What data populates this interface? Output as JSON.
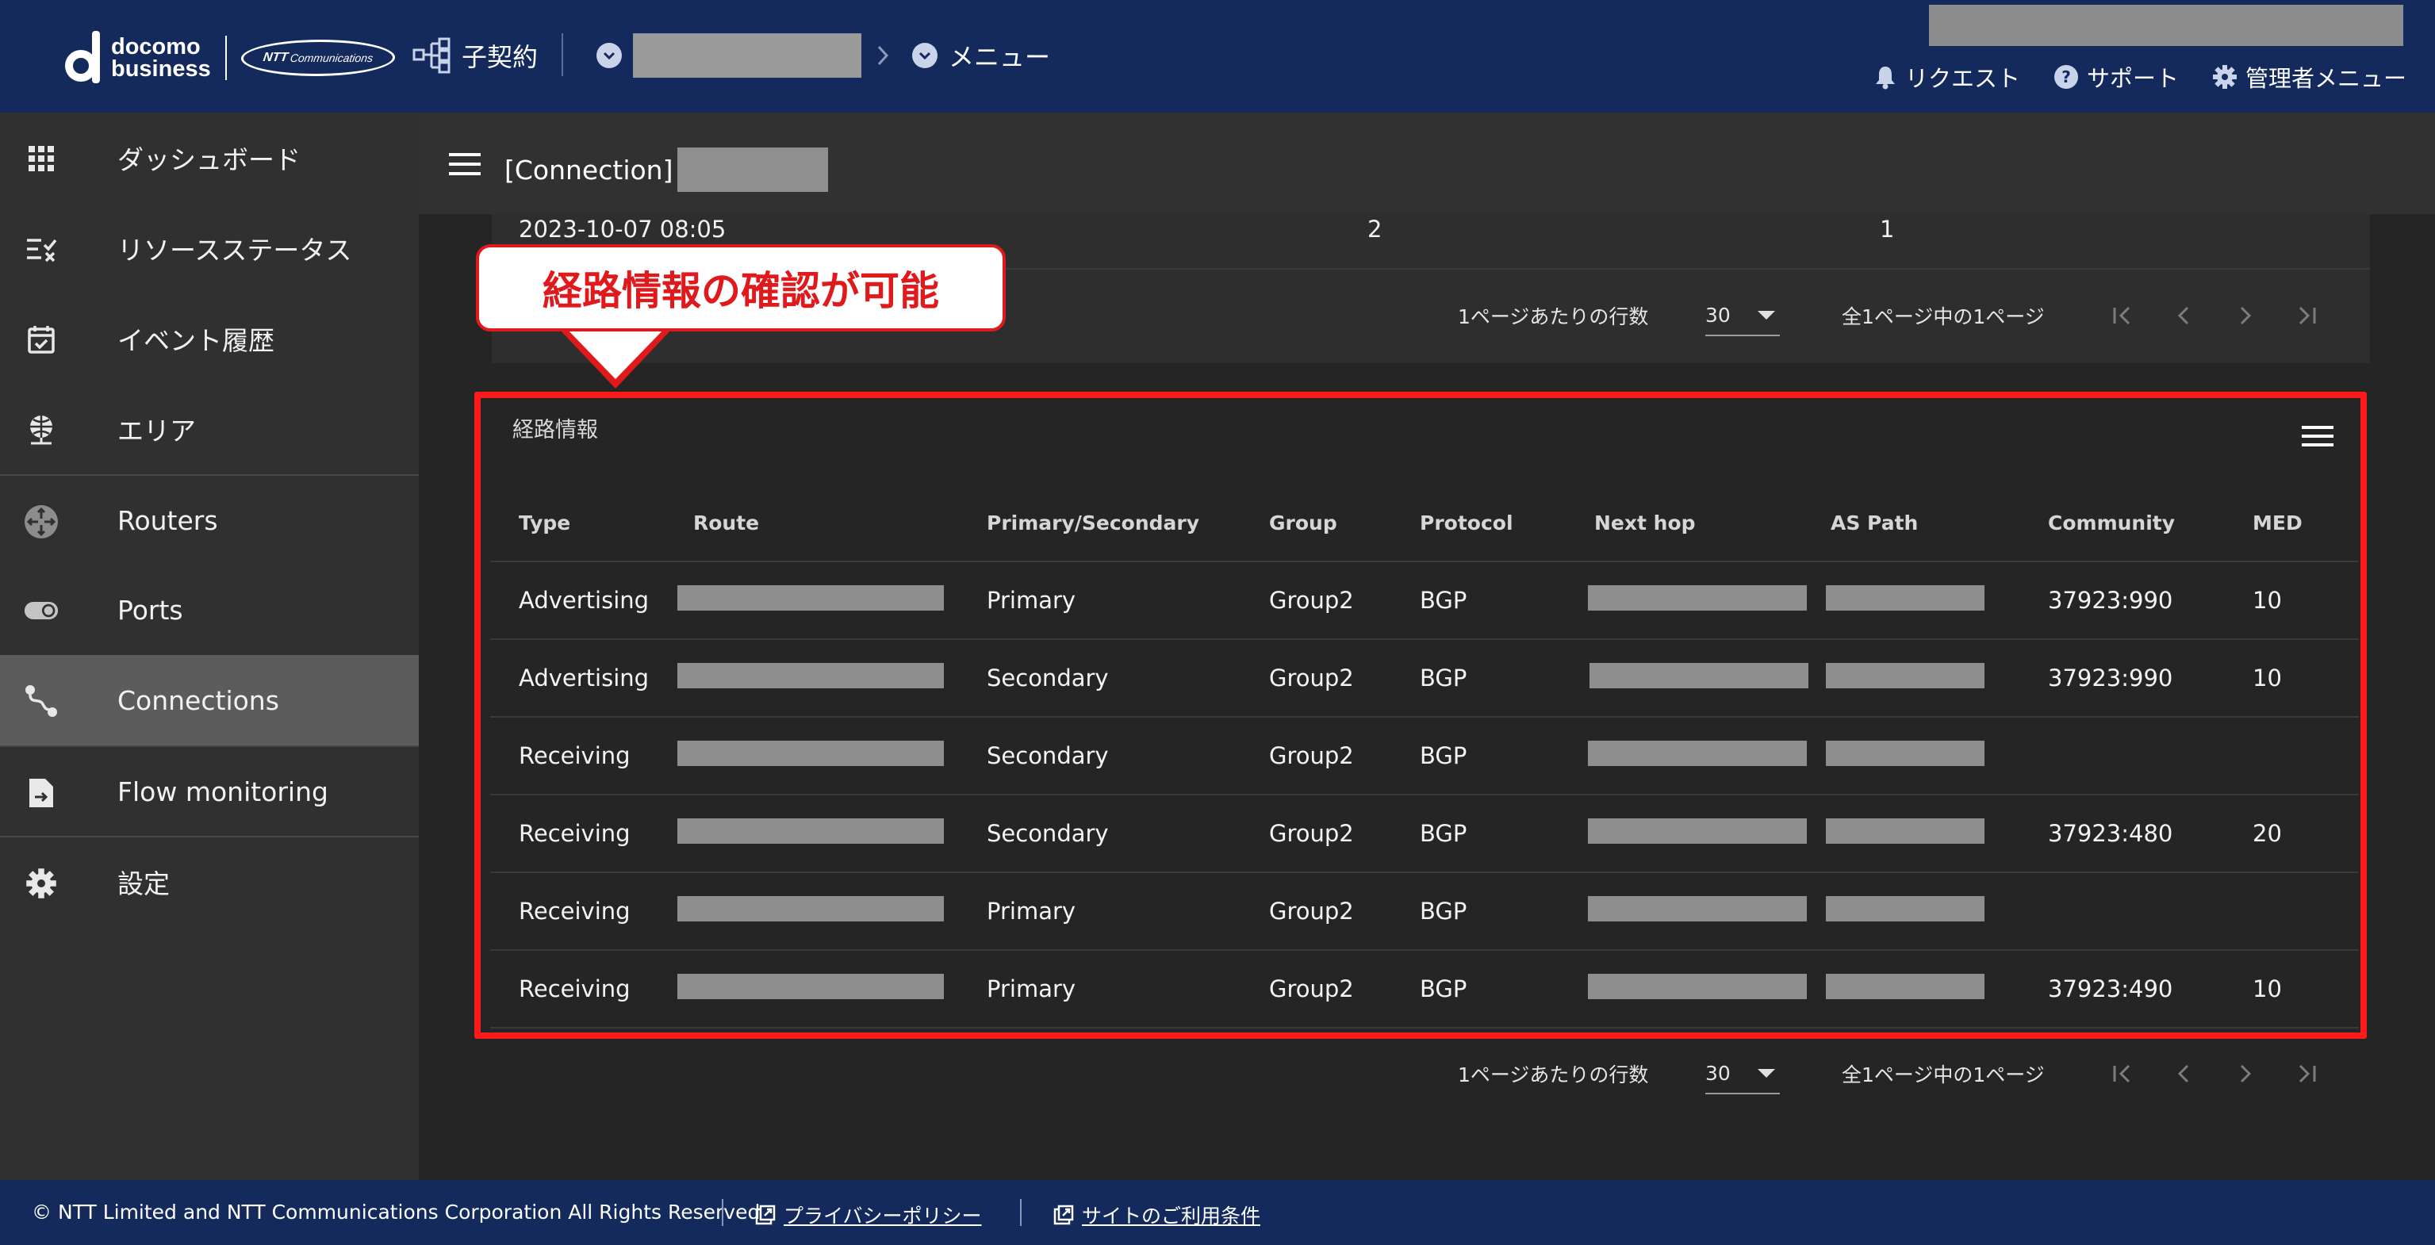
{
  "header": {
    "brand_line1": "docomo",
    "brand_line2": "business",
    "ntt_logo_main": "NTT",
    "ntt_logo_sub": "Communications",
    "contract_label": "子契約",
    "breadcrumb_menu": "メニュー",
    "links": [
      {
        "label": "リクエスト",
        "icon": "bell-icon"
      },
      {
        "label": "サポート",
        "icon": "help-icon"
      },
      {
        "label": "管理者メニュー",
        "icon": "gear-icon"
      }
    ]
  },
  "sidebar": {
    "items": [
      {
        "label": "ダッシュボード",
        "icon": "grid-icon"
      },
      {
        "label": "リソースステータス",
        "icon": "checklist-icon"
      },
      {
        "label": "イベント履歴",
        "icon": "calendar-check-icon"
      },
      {
        "label": "エリア",
        "icon": "globe-pin-icon"
      },
      {
        "label": "Routers",
        "icon": "router-icon"
      },
      {
        "label": "Ports",
        "icon": "toggle-icon"
      },
      {
        "label": "Connections",
        "icon": "route-icon",
        "active": true
      },
      {
        "label": "Flow monitoring",
        "icon": "file-arrow-icon"
      },
      {
        "label": "設定",
        "icon": "gear-icon"
      }
    ]
  },
  "appbar": {
    "title": "[Connection]"
  },
  "previous_table": {
    "row": {
      "date": "2023-10-07 08:05",
      "col2": "2",
      "col3": "1"
    },
    "pager": {
      "rows_per_page_label": "1ページあたりの行数",
      "rows_per_page": "30",
      "page_info": "全1ページ中の1ページ"
    }
  },
  "callout": {
    "text": "経路情報の確認が可能"
  },
  "routes": {
    "title": "経路情報",
    "columns": [
      "Type",
      "Route",
      "Primary/Secondary",
      "Group",
      "Protocol",
      "Next hop",
      "AS Path",
      "Community",
      "MED"
    ],
    "rows": [
      {
        "type": "Advertising",
        "ps": "Primary",
        "group": "Group2",
        "protocol": "BGP",
        "community": "37923:990",
        "med": "10"
      },
      {
        "type": "Advertising",
        "ps": "Secondary",
        "group": "Group2",
        "protocol": "BGP",
        "community": "37923:990",
        "med": "10"
      },
      {
        "type": "Receiving",
        "ps": "Secondary",
        "group": "Group2",
        "protocol": "BGP",
        "community": "",
        "med": ""
      },
      {
        "type": "Receiving",
        "ps": "Secondary",
        "group": "Group2",
        "protocol": "BGP",
        "community": "37923:480",
        "med": "20"
      },
      {
        "type": "Receiving",
        "ps": "Primary",
        "group": "Group2",
        "protocol": "BGP",
        "community": "",
        "med": ""
      },
      {
        "type": "Receiving",
        "ps": "Primary",
        "group": "Group2",
        "protocol": "BGP",
        "community": "37923:490",
        "med": "10"
      }
    ],
    "pager": {
      "rows_per_page_label": "1ページあたりの行数",
      "rows_per_page": "30",
      "page_info": "全1ページ中の1ページ"
    }
  },
  "footer": {
    "copyright": "© NTT Limited and NTT Communications Corporation All Rights Reserved.",
    "privacy": "プライバシーポリシー",
    "terms": "サイトのご利用条件"
  }
}
